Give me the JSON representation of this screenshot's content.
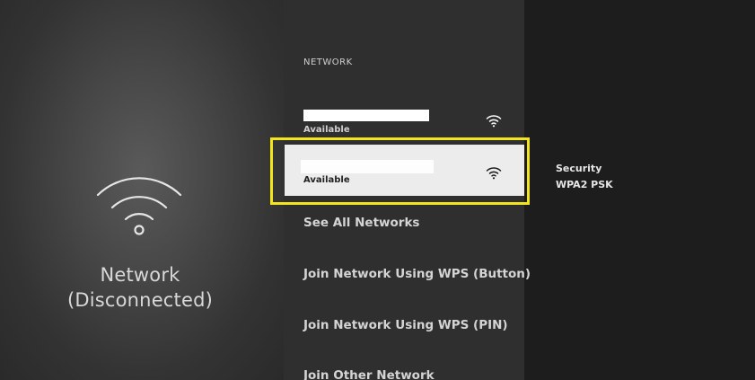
{
  "left_panel": {
    "icon": "wifi-icon",
    "title_line1": "Network",
    "title_line2": "(Disconnected)"
  },
  "network_list": {
    "header": "NETWORK",
    "items": [
      {
        "name": "",
        "status": "Available",
        "signal_icon": "wifi-icon",
        "name_redacted": true
      },
      {
        "name": "",
        "status": "Available",
        "signal_icon": "wifi-icon",
        "name_redacted": true,
        "selected": true
      }
    ],
    "menu": [
      {
        "label": "See All Networks"
      },
      {
        "label": "Join Network Using WPS (Button)"
      },
      {
        "label": "Join Network Using WPS (PIN)"
      },
      {
        "label": "Join Other Network"
      }
    ]
  },
  "details": {
    "security_label": "Security",
    "security_value": "WPA2 PSK"
  },
  "colors": {
    "highlight_border": "#f2e51c",
    "selected_background": "#ececec"
  }
}
